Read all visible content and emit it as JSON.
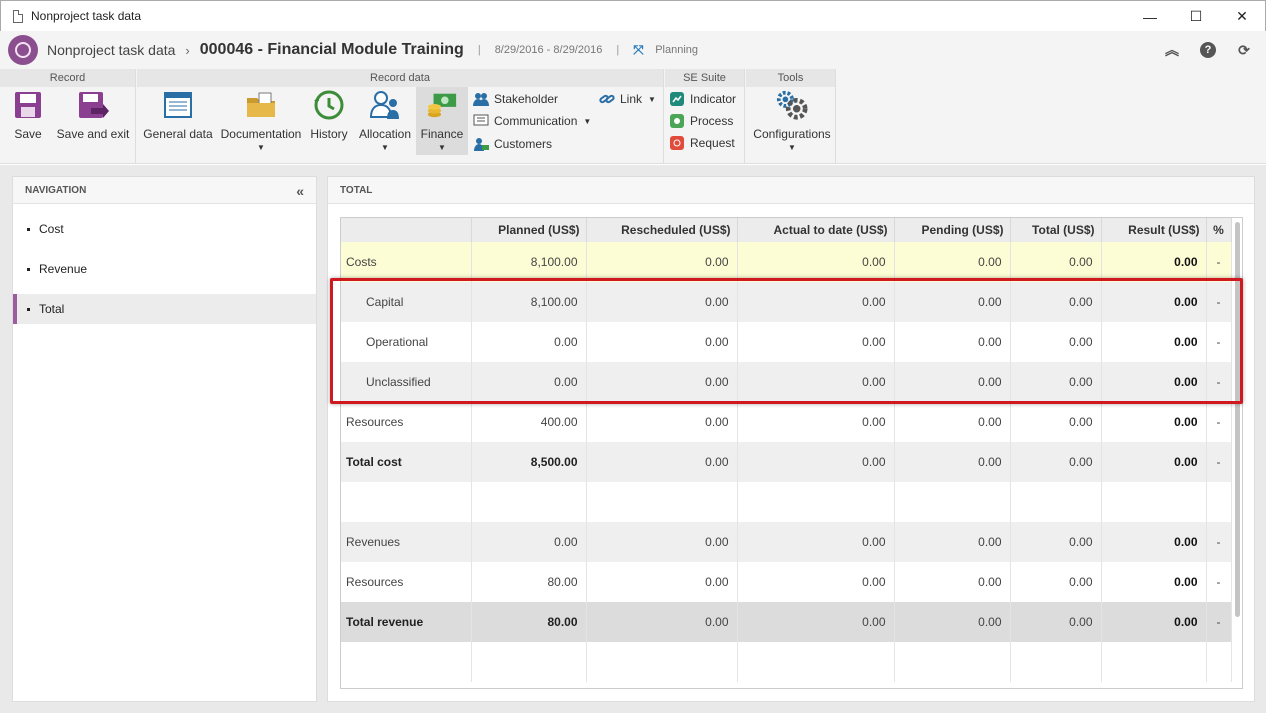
{
  "window": {
    "title": "Nonproject task data",
    "minimize": "—",
    "maximize": "☐",
    "close": "✕"
  },
  "header": {
    "breadcrumb": "Nonproject task data",
    "record_title": "000046 - Financial Module Training",
    "dates": "8/29/2016 - 8/29/2016",
    "phase": "Planning"
  },
  "ribbon": {
    "groups": {
      "record": "Record",
      "record_data": "Record data",
      "se_suite": "SE Suite",
      "tools": "Tools"
    },
    "save": "Save",
    "save_exit": "Save and exit",
    "general_data": "General data",
    "documentation": "Documentation",
    "history": "History",
    "allocation": "Allocation",
    "finance": "Finance",
    "stakeholder": "Stakeholder",
    "communication": "Communication",
    "customers": "Customers",
    "link": "Link",
    "indicator": "Indicator",
    "process": "Process",
    "request": "Request",
    "configurations": "Configurations"
  },
  "navigation": {
    "title": "NAVIGATION",
    "items": [
      {
        "label": "Cost"
      },
      {
        "label": "Revenue"
      },
      {
        "label": "Total"
      }
    ]
  },
  "main": {
    "title": "TOTAL",
    "columns": [
      "",
      "Planned (US$)",
      "Rescheduled (US$)",
      "Actual to date (US$)",
      "Pending (US$)",
      "Total (US$)",
      "Result (US$)",
      "%"
    ],
    "rows": [
      {
        "label": "Costs",
        "planned": "8,100.00",
        "rescheduled": "0.00",
        "actual": "0.00",
        "pending": "0.00",
        "total": "0.00",
        "result": "0.00",
        "pct": "-"
      },
      {
        "label": "Capital",
        "planned": "8,100.00",
        "rescheduled": "0.00",
        "actual": "0.00",
        "pending": "0.00",
        "total": "0.00",
        "result": "0.00",
        "pct": "-"
      },
      {
        "label": "Operational",
        "planned": "0.00",
        "rescheduled": "0.00",
        "actual": "0.00",
        "pending": "0.00",
        "total": "0.00",
        "result": "0.00",
        "pct": "-"
      },
      {
        "label": "Unclassified",
        "planned": "0.00",
        "rescheduled": "0.00",
        "actual": "0.00",
        "pending": "0.00",
        "total": "0.00",
        "result": "0.00",
        "pct": "-"
      },
      {
        "label": "Resources",
        "planned": "400.00",
        "rescheduled": "0.00",
        "actual": "0.00",
        "pending": "0.00",
        "total": "0.00",
        "result": "0.00",
        "pct": "-"
      },
      {
        "label": "Total cost",
        "planned": "8,500.00",
        "rescheduled": "0.00",
        "actual": "0.00",
        "pending": "0.00",
        "total": "0.00",
        "result": "0.00",
        "pct": "-"
      },
      {
        "label": "Revenues",
        "planned": "0.00",
        "rescheduled": "0.00",
        "actual": "0.00",
        "pending": "0.00",
        "total": "0.00",
        "result": "0.00",
        "pct": "-"
      },
      {
        "label": "Resources",
        "planned": "80.00",
        "rescheduled": "0.00",
        "actual": "0.00",
        "pending": "0.00",
        "total": "0.00",
        "result": "0.00",
        "pct": "-"
      },
      {
        "label": "Total revenue",
        "planned": "80.00",
        "rescheduled": "0.00",
        "actual": "0.00",
        "pending": "0.00",
        "total": "0.00",
        "result": "0.00",
        "pct": "-"
      }
    ]
  },
  "colors": {
    "accent": "#9c5d9f",
    "highlight": "#d0191f",
    "costs_row": "#fdfdd5"
  }
}
